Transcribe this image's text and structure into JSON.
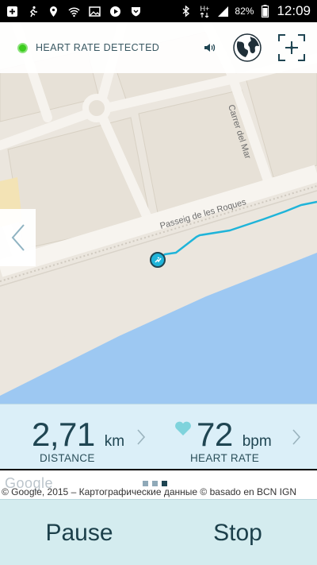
{
  "status_bar": {
    "battery": "82%",
    "network": "H+",
    "time": "12:09",
    "left_icons": [
      "plus-icon",
      "runner-icon",
      "location-pin-icon",
      "wifi-icon",
      "image-icon",
      "play-icon",
      "shield-icon"
    ],
    "right_icons": [
      "bluetooth-icon",
      "mobile-data-icon",
      "signal-icon",
      "battery-icon"
    ]
  },
  "topbar": {
    "status_text": "HEART RATE DETECTED",
    "indicator_color": "#3ccc1e"
  },
  "map": {
    "street_1": "Carrer del Mar",
    "street_2": "Passeig de les Roques",
    "route_color": "#1fb4d9",
    "water_color": "#9dc8f2"
  },
  "stats": {
    "distance": {
      "value": "2,71",
      "unit": "km",
      "label": "DISTANCE"
    },
    "heart_rate": {
      "value": "72",
      "unit": "bpm",
      "label": "HEART RATE"
    }
  },
  "footer": {
    "google_logo": "Google",
    "attribution": "© Google, 2015 – Картографические данные © basado en BCN IGN",
    "pages": 3,
    "active_page": 3
  },
  "actions": {
    "pause_label": "Pause",
    "stop_label": "Stop"
  }
}
